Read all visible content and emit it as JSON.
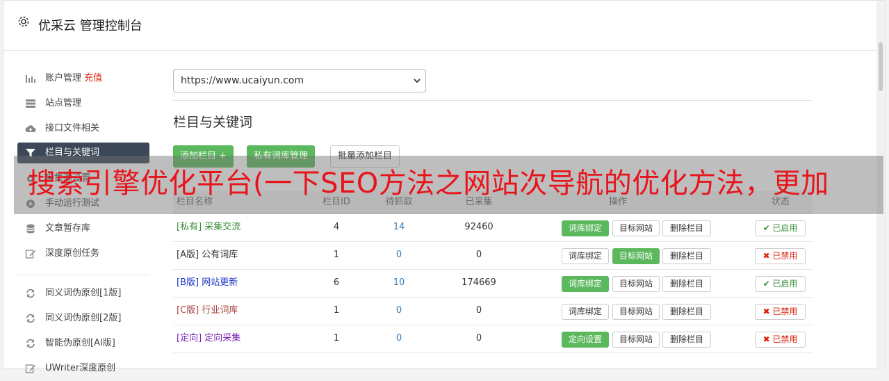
{
  "header": {
    "title": "优采云 管理控制台",
    "icon": "gear-icon"
  },
  "sidebar": {
    "items": [
      {
        "label": "账户管理",
        "extra": "充值",
        "icon": "bar-chart-icon"
      },
      {
        "label": "站点管理",
        "icon": "server-icon"
      },
      {
        "label": "接口文件相关",
        "icon": "cloud-upload-icon"
      },
      {
        "label": "栏目与关键词",
        "icon": "filter-icon",
        "active": true
      },
      {
        "label": "采集源设置",
        "icon": "gear-icon"
      },
      {
        "label": "手动运行测试",
        "icon": "play-icon"
      },
      {
        "label": "文章暂存库",
        "icon": "database-icon"
      },
      {
        "label": "深度原创任务",
        "icon": "edit-icon"
      }
    ],
    "items2": [
      {
        "label": "同义词伪原创[1版]",
        "icon": "refresh-icon"
      },
      {
        "label": "同义词伪原创[2版]",
        "icon": "refresh-icon"
      },
      {
        "label": "智能伪原创[AI版]",
        "icon": "refresh-icon"
      },
      {
        "label": "UWriter深度原创",
        "icon": "edit-icon"
      }
    ]
  },
  "main": {
    "url_select": "https://www.ucaiyun.com",
    "section_title": "栏目与关键词",
    "buttons": {
      "add_column": "添加栏目 +",
      "private_lib": "私有词库管理",
      "batch_add": "批量添加栏目"
    }
  },
  "table": {
    "headers": [
      "栏目名称",
      "栏目ID",
      "待抓取",
      "已采集",
      "操作",
      "状态"
    ],
    "rows": [
      {
        "tag": "[私有]",
        "name": "采集交流",
        "id": "4",
        "wait": "14",
        "done": "92460",
        "op1": "词库绑定",
        "op1_green": true,
        "op2": "目标网站",
        "op2_green": false,
        "op3": "删除栏目",
        "status": "✔ 已启用",
        "enabled": true,
        "color": "#3c8d3c"
      },
      {
        "tag": "[A版]",
        "name": "公有词库",
        "id": "1",
        "wait": "0",
        "done": "0",
        "op1": "词库绑定",
        "op1_green": false,
        "op2": "目标网站",
        "op2_green": true,
        "op3": "删除栏目",
        "status": "✖ 已禁用",
        "enabled": false,
        "color": "#333333"
      },
      {
        "tag": "[B版]",
        "name": "网站更新",
        "id": "6",
        "wait": "10",
        "done": "174669",
        "op1": "词库绑定",
        "op1_green": true,
        "op2": "目标网站",
        "op2_green": false,
        "op3": "删除栏目",
        "status": "✔ 已启用",
        "enabled": true,
        "color": "#1a35c9"
      },
      {
        "tag": "[C版]",
        "name": "行业词库",
        "id": "1",
        "wait": "0",
        "done": "0",
        "op1": "词库绑定",
        "op1_green": false,
        "op2": "目标网站",
        "op2_green": false,
        "op3": "删除栏目",
        "status": "✖ 已禁用",
        "enabled": false,
        "color": "#a94442"
      },
      {
        "tag": "[定向]",
        "name": "定向采集",
        "id": "1",
        "wait": "0",
        "done": "0",
        "op1": "定向设置",
        "op1_green": true,
        "op2": "目标网站",
        "op2_green": false,
        "op3": "删除栏目",
        "status": "✖ 已禁用",
        "enabled": false,
        "color": "#7a1fb5"
      }
    ]
  },
  "banner": {
    "text": "搜索引擎优化平台(一下SEO方法之网站次导航的优化方法，更加"
  }
}
